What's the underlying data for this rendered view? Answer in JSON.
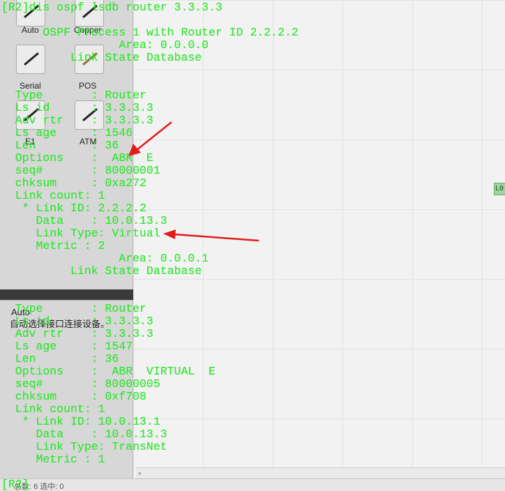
{
  "background_app": {
    "device_labels": [
      "Auto",
      "Copper",
      "Serial",
      "POS",
      "E1",
      "ATM"
    ],
    "panel_title": "Auto",
    "panel_description": "自动选择接口连接设备。",
    "canvas_tag": "L0",
    "status_text": "总数: 6  选中: 0"
  },
  "console": {
    "lines": [
      "[R2]dis ospf lsdb router 3.3.3.3",
      "",
      "      OSPF Process 1 with Router ID 2.2.2.2",
      "                 Area: 0.0.0.0",
      "          Link State Database",
      "",
      "",
      "  Type       : Router",
      "  Ls id      : 3.3.3.3",
      "  Adv rtr    : 3.3.3.3",
      "  Ls age     : 1546",
      "  Len        : 36",
      "  Options    :  ABR  E",
      "  seq#       : 80000001",
      "  chksum     : 0xa272",
      "  Link count: 1",
      "   * Link ID: 2.2.2.2",
      "     Data    : 10.0.13.3",
      "     Link Type: Virtual",
      "     Metric : 2",
      "                 Area: 0.0.0.1",
      "          Link State Database",
      "",
      "",
      "  Type       : Router",
      "  Ls id      : 3.3.3.3",
      "  Adv rtr    : 3.3.3.3",
      "  Ls age     : 1547",
      "  Len        : 36",
      "  Options    :  ABR  VIRTUAL  E",
      "  seq#       : 80000005",
      "  chksum     : 0xf708",
      "  Link count: 1",
      "   * Link ID: 10.0.13.1",
      "     Data    : 10.0.13.3",
      "     Link Type: TransNet",
      "     Metric : 1",
      "",
      "[R2]"
    ],
    "text_color": "#2fe62f"
  },
  "annotations": {
    "arrow_color": "#e31b1b",
    "arrows": [
      "options-arrow",
      "link-type-arrow"
    ]
  }
}
